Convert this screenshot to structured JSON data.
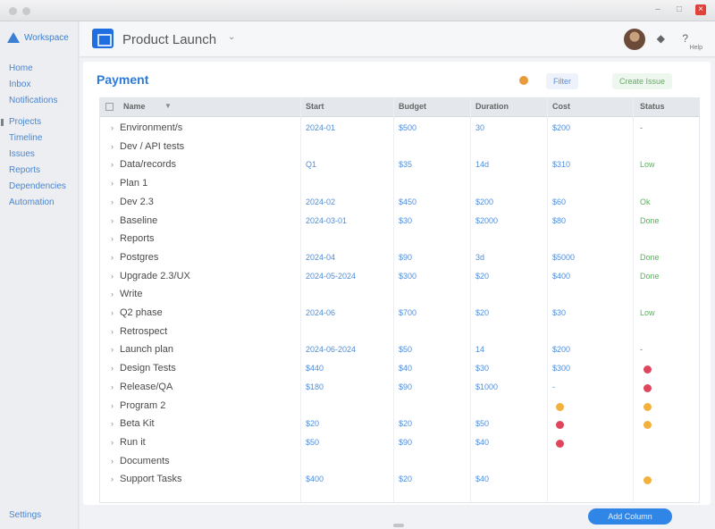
{
  "window": {
    "title": ""
  },
  "sidebar": {
    "brand": "Workspace",
    "items": [
      "Home",
      "Inbox",
      "Notifications",
      "Projects",
      "Timeline",
      "Issues",
      "Reports",
      "Dependencies",
      "Automation"
    ],
    "footer": "Settings"
  },
  "header": {
    "project_name": "Product Launch",
    "notify_icon": "bell-icon",
    "help_icon": "help-icon",
    "help_small": "Help"
  },
  "card": {
    "title": "Payment",
    "filter_chip": "Filter",
    "action_chip": "Create Issue",
    "columns": [
      "Name",
      "Start",
      "Budget",
      "Duration",
      "Cost",
      "Status"
    ]
  },
  "rows": [
    {
      "name": "Environment/s",
      "start": "2024-01",
      "budget": "$500",
      "duration": "30",
      "cost": "$200",
      "status": "-"
    },
    {
      "name": "Dev / API tests",
      "start": "",
      "budget": "",
      "duration": "",
      "cost": "",
      "status": ""
    },
    {
      "name": "Data/records",
      "start": "Q1",
      "budget": "$35",
      "duration": "14d",
      "cost": "$310",
      "status": "Low"
    },
    {
      "name": "Plan 1",
      "start": "",
      "budget": "",
      "duration": "",
      "cost": "",
      "status": ""
    },
    {
      "name": "Dev 2.3",
      "start": "2024-02",
      "budget": "$450",
      "duration": "$200",
      "cost": "$60",
      "status": "Ok"
    },
    {
      "name": "Baseline",
      "start": "2024-03-01",
      "budget": "$30",
      "duration": "$2000",
      "cost": "$80",
      "status": "Done"
    },
    {
      "name": "Reports",
      "start": "",
      "budget": "",
      "duration": "",
      "cost": "",
      "status": ""
    },
    {
      "name": "Postgres",
      "start": "2024-04",
      "budget": "$90",
      "duration": "3d",
      "cost": "$5000",
      "status": "Done"
    },
    {
      "name": "Upgrade 2.3/UX",
      "start": "2024-05-2024",
      "budget": "$300",
      "duration": "$20",
      "cost": "$400",
      "status": "Done"
    },
    {
      "name": "Write",
      "start": "",
      "budget": "",
      "duration": "",
      "cost": "",
      "status": ""
    },
    {
      "name": "Q2 phase",
      "start": "2024-06",
      "budget": "$700",
      "duration": "$20",
      "cost": "$30",
      "status": "Low"
    },
    {
      "name": "Retrospect",
      "start": "",
      "budget": "",
      "duration": "",
      "cost": "",
      "status": ""
    },
    {
      "name": "Launch plan",
      "start": "2024-06-2024",
      "budget": "$50",
      "duration": "14",
      "cost": "$200",
      "status": "-"
    },
    {
      "name": "Design Tests",
      "start": "$440",
      "budget": "$40",
      "duration": "$30",
      "cost": "$300",
      "status": ""
    },
    {
      "name": "Release/QA",
      "start": "$180",
      "budget": "$90",
      "duration": "$1000",
      "cost": "-",
      "status": ""
    },
    {
      "name": "Program 2",
      "start": "",
      "budget": "",
      "duration": "",
      "cost": "",
      "status": ""
    },
    {
      "name": "Beta Kit",
      "start": "$20",
      "budget": "$20",
      "duration": "$50",
      "cost": "",
      "status": ""
    },
    {
      "name": "Run it",
      "start": "$50",
      "budget": "$90",
      "duration": "$40",
      "cost": "",
      "status": ""
    },
    {
      "name": "Documents",
      "start": "",
      "budget": "",
      "duration": "",
      "cost": "",
      "status": ""
    },
    {
      "name": "Support Tasks",
      "start": "$400",
      "budget": "$20",
      "duration": "$40",
      "cost": "",
      "status": ""
    }
  ],
  "status_markers": [
    {
      "row": 13,
      "col": "status",
      "kind": "red"
    },
    {
      "row": 14,
      "col": "status",
      "kind": "red"
    },
    {
      "row": 15,
      "col": "cost",
      "kind": "amber"
    },
    {
      "row": 15,
      "col": "status",
      "kind": "amber"
    },
    {
      "row": 16,
      "col": "cost",
      "kind": "red"
    },
    {
      "row": 16,
      "col": "status",
      "kind": "amber"
    },
    {
      "row": 17,
      "col": "cost",
      "kind": "red"
    },
    {
      "row": 19,
      "col": "status",
      "kind": "amber"
    }
  ],
  "footer": {
    "primary_button": "Add Column"
  },
  "colors": {
    "accent": "#2c7ad6",
    "positive": "#59b35c",
    "danger": "#e0465b",
    "warning": "#f2b13c"
  }
}
